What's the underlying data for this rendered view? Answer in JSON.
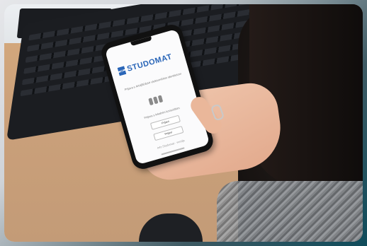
{
  "photo": {
    "description_free": true
  },
  "phone_screen": {
    "logo_text": "STUDOMAT",
    "prompt_1": "Prijava s AAI@EduHr elektroničkim identitetom",
    "prompt_2": "Prijava s lokalnim korisničkim",
    "button_1": "Prijavi",
    "button_2": "Prijavi",
    "footer": "Info Studomat · verzija"
  },
  "colors": {
    "brand": "#2a66b8",
    "frame_accent": "#0f4c5b"
  }
}
